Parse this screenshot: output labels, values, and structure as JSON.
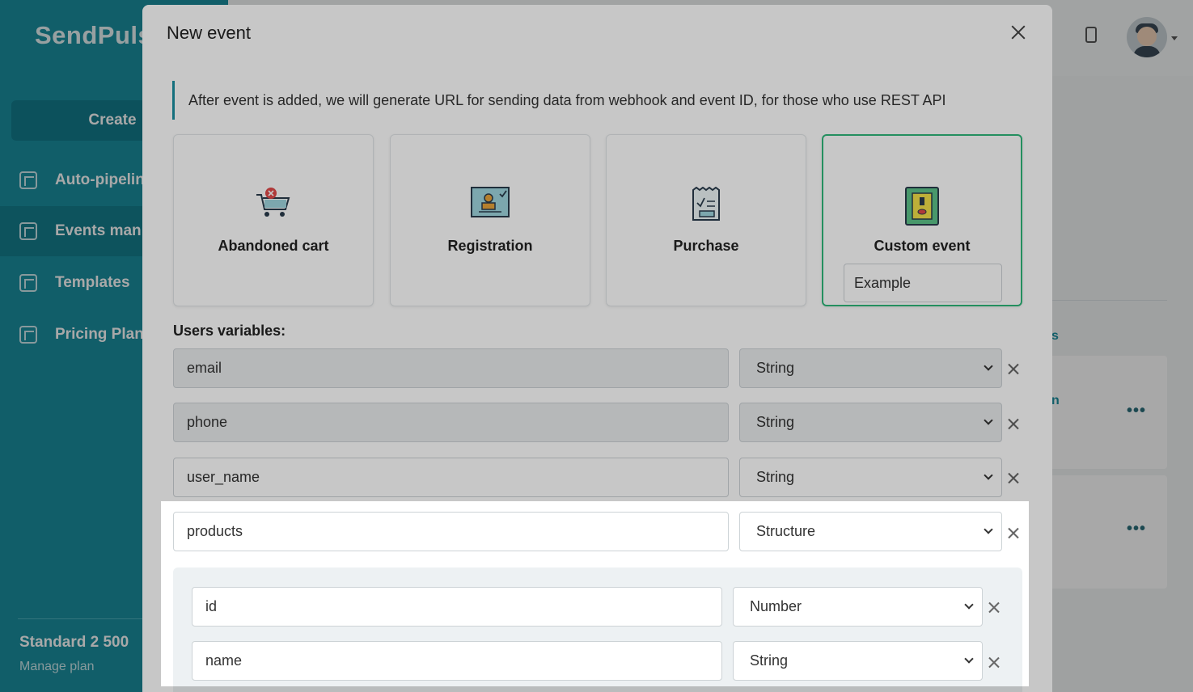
{
  "app": {
    "logo_text": "SendPuls",
    "create_label": "Create",
    "nav": [
      {
        "label": "Auto-pipelin",
        "icon": "pipeline-icon"
      },
      {
        "label": "Events man",
        "icon": "events-icon"
      },
      {
        "label": "Templates",
        "icon": "templates-icon"
      },
      {
        "label": "Pricing Plan",
        "icon": "wallet-icon"
      }
    ],
    "plan_name": "Standard 2 500",
    "manage_plan": "Manage plan",
    "bg_fragment_1": "s",
    "bg_fragment_2": "n",
    "more_dots": "•••"
  },
  "modal": {
    "title": "New event",
    "info_text": "After event is added, we will generate URL for sending data from webhook and event ID, for those who use REST API",
    "cards": [
      {
        "label": "Abandoned cart",
        "icon": "cart-icon",
        "selected": false
      },
      {
        "label": "Registration",
        "icon": "registration-icon",
        "selected": false
      },
      {
        "label": "Purchase",
        "icon": "receipt-icon",
        "selected": false
      },
      {
        "label": "Custom event",
        "icon": "custom-event-icon",
        "selected": true
      }
    ],
    "custom_event_input_value": "Example",
    "variables_title": "Users variables:",
    "variables": [
      {
        "name": "email",
        "type": "String"
      },
      {
        "name": "phone",
        "type": "String"
      },
      {
        "name": "user_name",
        "type": "String"
      },
      {
        "name": "products",
        "type": "Structure"
      }
    ],
    "nested_variables": [
      {
        "name": "id",
        "type": "Number"
      },
      {
        "name": "name",
        "type": "String"
      }
    ]
  },
  "colors": {
    "accent": "#1a8fa0",
    "selected_border": "#2fb87a"
  }
}
